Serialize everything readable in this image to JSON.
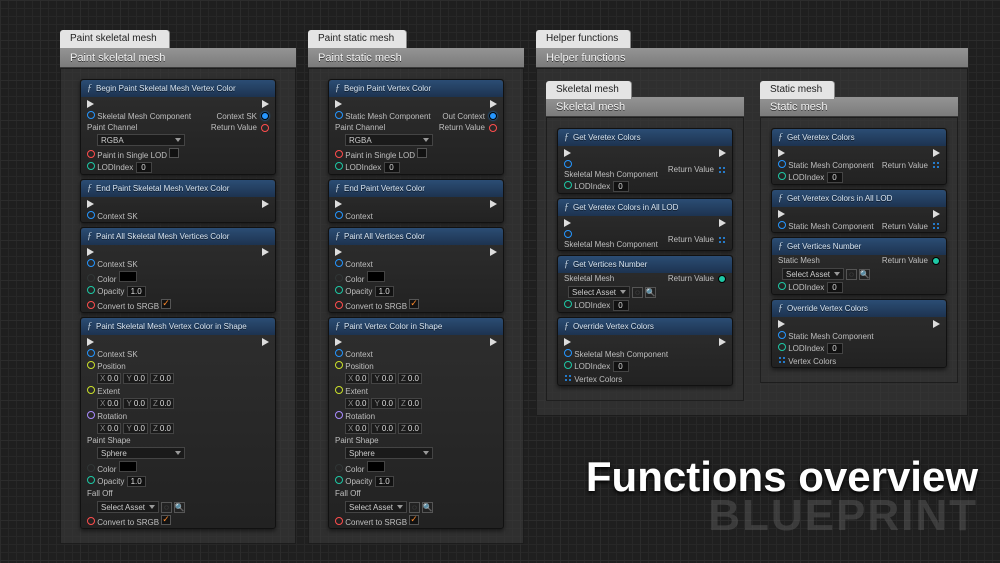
{
  "overview_title": "Functions overview",
  "overview_sub": "BLUEPRINT",
  "labels": {
    "return_value": "Return Value",
    "paint_channel_lbl": "Paint Channel",
    "paint_channel_val": "RGBA",
    "paint_single_lod": "Paint in Single LOD",
    "lodindex": "LODIndex",
    "context_sk": "Context SK",
    "context": "Context",
    "skel_comp": "Skeletal Mesh Component",
    "static_comp": "Static Mesh Component",
    "out_context": "Out Context",
    "color": "Color",
    "opacity": "Opacity",
    "opacity_val": "1.0",
    "convert_srgb": "Convert to SRGB",
    "position": "Position",
    "extent": "Extent",
    "rotation": "Rotation",
    "paint_shape": "Paint Shape",
    "shape_sphere": "Sphere",
    "falloff": "Fall Off",
    "select_asset": "Select Asset",
    "skel_mesh": "Skeletal Mesh",
    "static_mesh": "Static Mesh",
    "vertex_colors": "Vertex Colors",
    "zero": "0",
    "x0": "X",
    "y0": "Y",
    "z0": "Z",
    "zeroF": "0.0"
  },
  "sections": {
    "skel": {
      "tab": "Paint skeletal mesh",
      "title": "Paint skeletal mesh"
    },
    "stat": {
      "tab": "Paint static mesh",
      "title": "Paint static mesh"
    },
    "help": {
      "tab": "Helper functions",
      "title": "Helper functions"
    },
    "help_sk": {
      "tab": "Skeletal mesh",
      "title": "Skeletal mesh"
    },
    "help_st": {
      "tab": "Static mesh",
      "title": "Static mesh"
    }
  },
  "nodes": {
    "begin_skel": "Begin Paint Skeletal Mesh Vertex Color",
    "end_skel": "End Paint Skeletal Mesh Vertex Color",
    "paint_all_skel": "Paint All Skeletal Mesh Vertices Color",
    "paint_skel_shape": "Paint Skeletal Mesh Vertex Color in Shape",
    "begin_stat": "Begin Paint Vertex Color",
    "end_stat": "End Paint Vertex Color",
    "paint_all_stat": "Paint All Vertices Color",
    "paint_stat_shape": "Paint Vertex Color in Shape",
    "get_vcolors": "Get Veretex Colors",
    "get_vcolors_alllod": "Get Veretex Colors in All LOD",
    "get_vnumber": "Get Vertices Number",
    "override_v": "Override Vertex Colors"
  }
}
